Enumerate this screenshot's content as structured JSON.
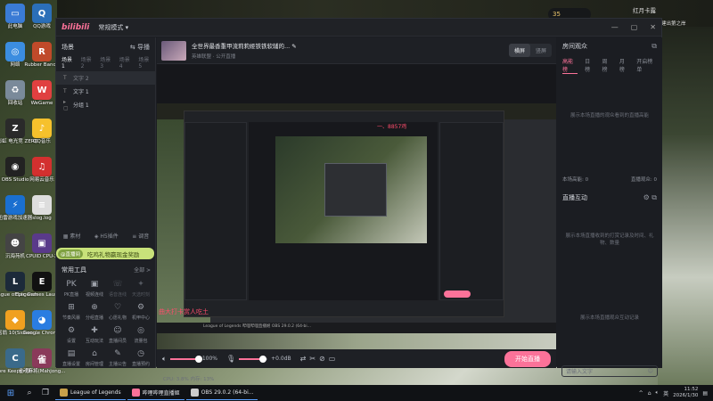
{
  "desktop": {
    "icons": [
      {
        "label": "此电脑",
        "color": "#3a7bd5",
        "glyph": "▭"
      },
      {
        "label": "QQ游戏",
        "color": "#2b6fb8",
        "glyph": "Q"
      },
      {
        "label": "网络",
        "color": "#3b8de0",
        "glyph": "◎"
      },
      {
        "label": "Rubber Bandit",
        "color": "#c04a2a",
        "glyph": "R"
      },
      {
        "label": "回收站",
        "color": "#7a8a9a",
        "glyph": "♻"
      },
      {
        "label": "WeGame",
        "color": "#e04040",
        "glyph": "W"
      },
      {
        "label": "七彩虹 电光竞 ZERO",
        "color": "#2a2a2a",
        "glyph": "Z"
      },
      {
        "label": "QQ音乐",
        "color": "#f6c12c",
        "glyph": "♪"
      },
      {
        "label": "OBS Studio",
        "color": "#222",
        "glyph": "◉"
      },
      {
        "label": "网易云音乐",
        "color": "#d3302f",
        "glyph": "♫"
      },
      {
        "label": "迅雷游戏加速器",
        "color": "#1a6fd0",
        "glyph": "⚡"
      },
      {
        "label": "slog.log",
        "color": "#ddd",
        "glyph": "≡"
      },
      {
        "label": "沉海苑机",
        "color": "#444",
        "glyph": "☻"
      },
      {
        "label": "CPUID CPU-Z",
        "color": "#5a3a8a",
        "glyph": "▣"
      },
      {
        "label": "League of Legends",
        "color": "#1c2a3a",
        "glyph": "L"
      },
      {
        "label": "Epic Games Launcher",
        "color": "#111",
        "glyph": "E"
      },
      {
        "label": "大富翁 10(Sichen...",
        "color": "#f0a020",
        "glyph": "◆"
      },
      {
        "label": "Google Chrome",
        "color": "#2a7de1",
        "glyph": "◕"
      },
      {
        "label": "Core Keeper 联...",
        "color": "#3a6a8a",
        "glyph": "C"
      },
      {
        "label": "雀魂麻将(Mahjong...",
        "color": "#8a3a5a",
        "glyph": "雀"
      }
    ]
  },
  "bg": {
    "badge": "35",
    "user": "红月卡露",
    "user_sub": "建出第之岸"
  },
  "app": {
    "logo": "bilibili",
    "mode": "常规模式",
    "left": {
      "scenes_title": "场景",
      "import_label": "导播",
      "scene_tabs": [
        "场景1",
        "场景2",
        "场景3",
        "场景4",
        "场景5"
      ],
      "sources": [
        {
          "label": "文字 2",
          "glyph": "T"
        },
        {
          "label": "文字 1",
          "glyph": "T"
        },
        {
          "label": "分组 1",
          "glyph": "▸ ▢"
        }
      ],
      "tools_row": [
        "素材",
        "H5插件",
        "调音"
      ],
      "banner_tag": "@直播间",
      "banner_text": "吃鸡礼物赢现金奖励",
      "common_tools_title": "常用工具",
      "all_label": "全部 >",
      "tools": [
        {
          "label": "PK直播",
          "glyph": "PK",
          "dim": false
        },
        {
          "label": "视频连线",
          "glyph": "▣",
          "dim": false
        },
        {
          "label": "语音连线",
          "glyph": "☏",
          "dim": true
        },
        {
          "label": "天选时刻",
          "glyph": "✦",
          "dim": true
        },
        {
          "label": "节奏风暴",
          "glyph": "⊞",
          "dim": false
        },
        {
          "label": "分组直播",
          "glyph": "⊕",
          "dim": false
        },
        {
          "label": "心愿礼物",
          "glyph": "♡",
          "dim": false
        },
        {
          "label": "机甲中心",
          "glyph": "⚙",
          "dim": false
        },
        {
          "label": "设置",
          "glyph": "⚙",
          "dim": false
        },
        {
          "label": "互动玩法",
          "glyph": "✚",
          "dim": false
        },
        {
          "label": "直播间员",
          "glyph": "☺",
          "dim": false
        },
        {
          "label": "流量包",
          "glyph": "◎",
          "dim": false
        },
        {
          "label": "直播设置",
          "glyph": "▤",
          "dim": false
        },
        {
          "label": "房间管理",
          "glyph": "⌂",
          "dim": false
        },
        {
          "label": "主播公告",
          "glyph": "✎",
          "dim": false
        },
        {
          "label": "直播预约",
          "glyph": "◷",
          "dim": false
        }
      ]
    },
    "center": {
      "title": "全世界最香重甲流莉莉娅铁铁软辅的...",
      "category": "英雄联盟",
      "visibility": "公开直播",
      "orient_h": "横屏",
      "orient_v": "竖屏",
      "nested_red1": "一、8857鸡",
      "nested_red2": "曲大打卡赏人吃土",
      "nested_task": "League of Legends   哔哩哔哩直播姬   OBS 29.0.2 (64-bi...",
      "volume_pct": "100%",
      "volume_level": 1.0,
      "mic_level": 0.85,
      "mic_db": "+0.0dB",
      "start_label": "开始直播",
      "status": "CPU: 3.8%   内存: 13%"
    },
    "right": {
      "rank_title": "房间观众",
      "rank_tabs": [
        "高能榜",
        "日榜",
        "周榜",
        "月榜",
        "开启榜单"
      ],
      "rank_empty": "展示本场直播的观众看到的直播高能",
      "count_label": "本场高能: 0",
      "count_right": "直播观众: 0",
      "interact_title": "直播互动",
      "interact_empty": "展示本场直播收到的打赏记录及时间、礼物、数量",
      "interact_empty2": "展示本场直播观众互动记录",
      "chat_placeholder": "请输入文字"
    }
  },
  "taskbar": {
    "apps": [
      {
        "label": "League of Legends",
        "color": "#c8a04a"
      },
      {
        "label": "哔哩哔哩直播姬",
        "color": "#fb7299"
      },
      {
        "label": "OBS 29.0.2 (64-bi...",
        "color": "#cccccc"
      }
    ],
    "time": "11:52",
    "date": "2026/1/30",
    "lang": "英"
  }
}
